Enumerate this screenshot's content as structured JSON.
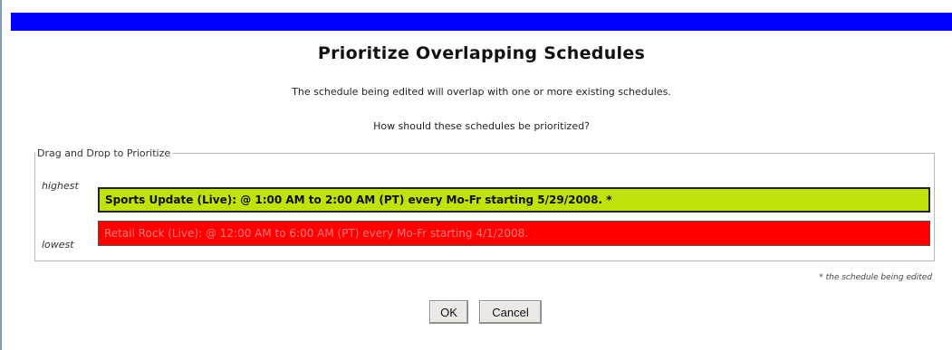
{
  "dialog": {
    "title": "Prioritize Overlapping Schedules",
    "message_1": "The schedule being edited will overlap with one or more existing schedules.",
    "message_2": "How should these schedules be prioritized?"
  },
  "priority_group": {
    "legend": "Drag and Drop to Prioritize",
    "highest_label": "highest",
    "lowest_label": "lowest",
    "schedules": [
      {
        "label": "Sports Update (Live): @ 1:00 AM to 2:00 AM (PT) every Mo-Fr starting 5/29/2008. *",
        "color": "#c1e10a"
      },
      {
        "label": "Retail Rock (Live): @ 12:00 AM to 6:00 AM (PT) every Mo-Fr starting 4/1/2008.",
        "color": "#ff0000"
      }
    ]
  },
  "footnote": "* the schedule being edited",
  "buttons": {
    "ok": "OK",
    "cancel": "Cancel"
  },
  "colors": {
    "title_bar": "#0000ff"
  }
}
